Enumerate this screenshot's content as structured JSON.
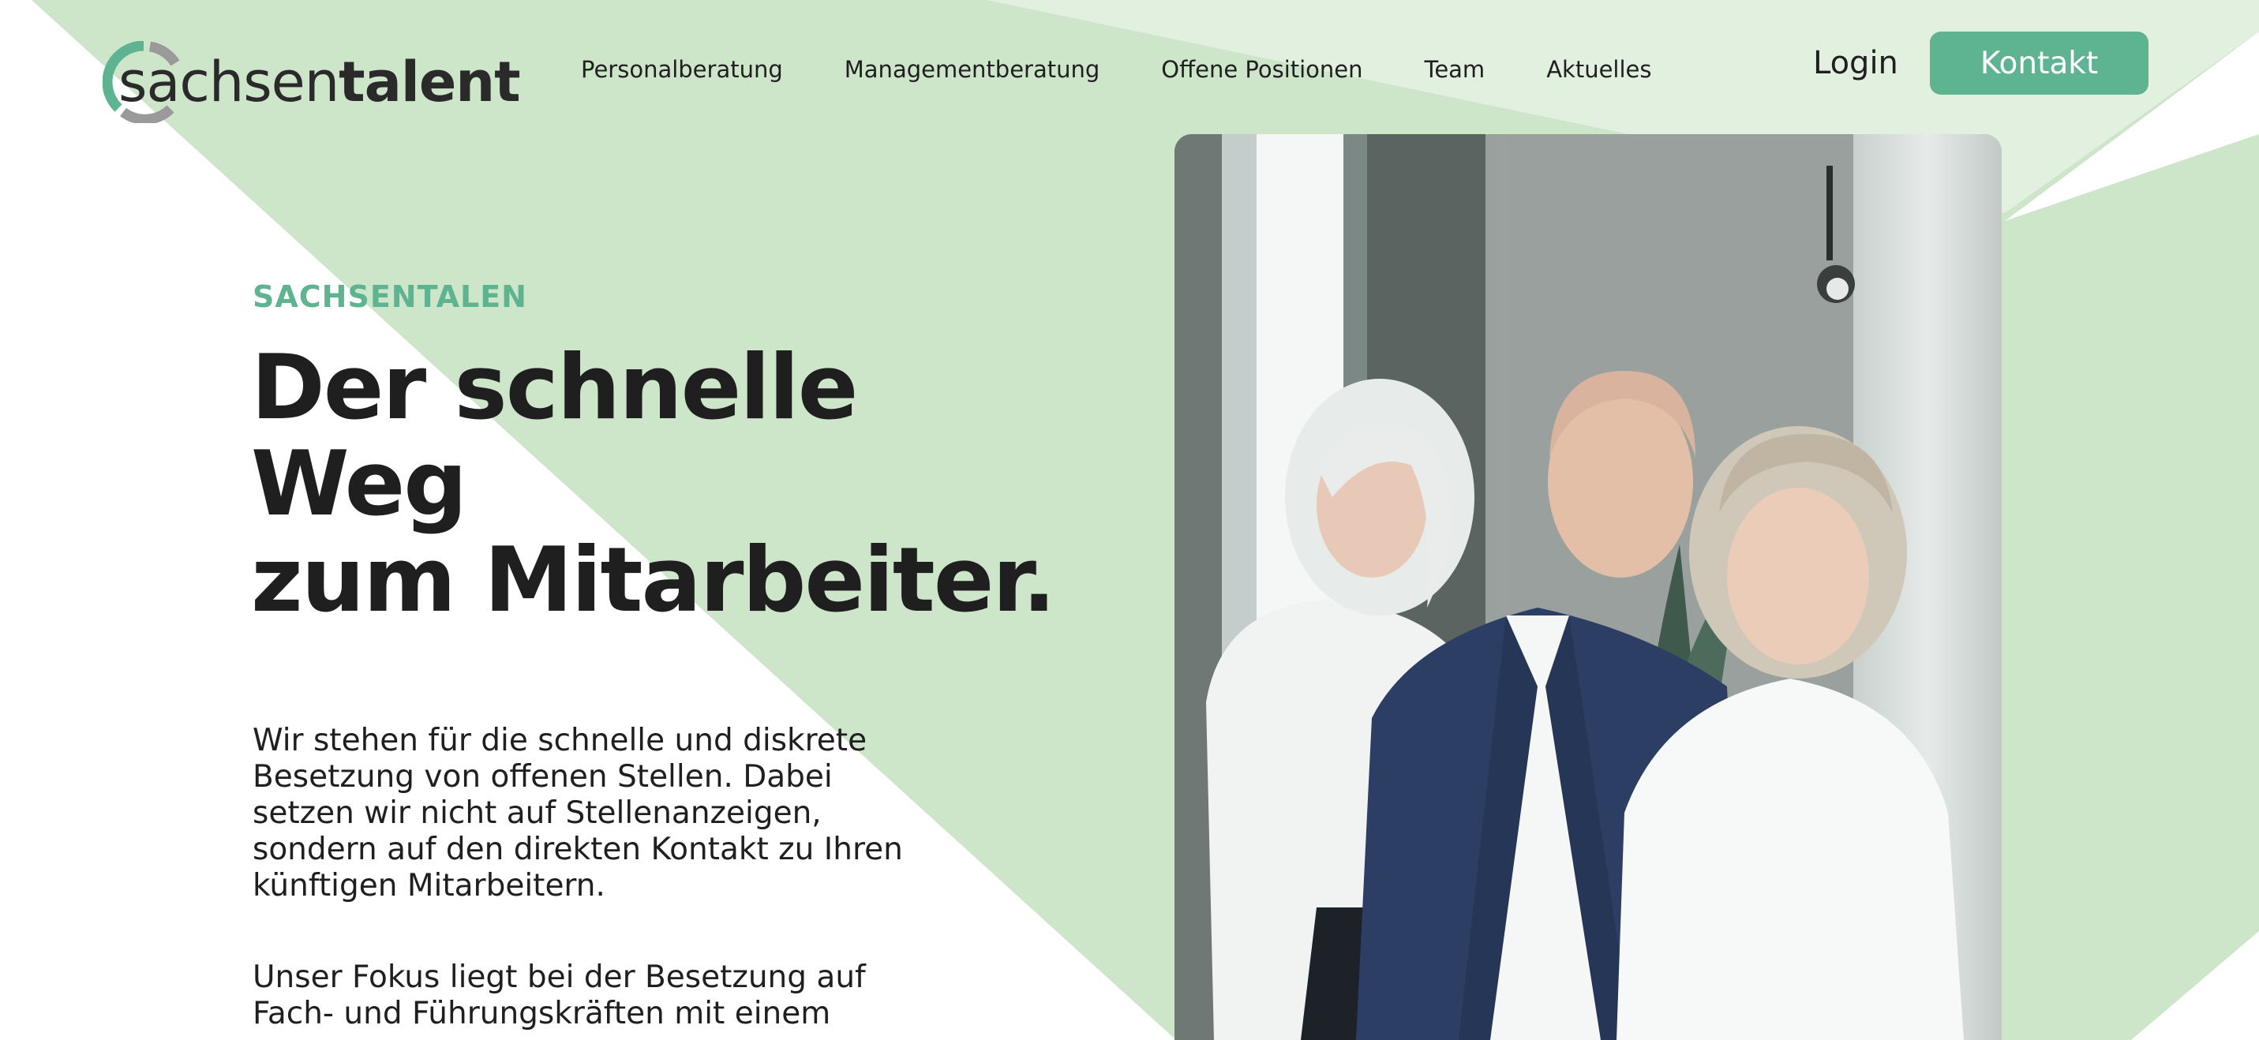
{
  "logo": {
    "text_light": "sachsen",
    "text_bold": "talent",
    "brand_color": "#5eb391",
    "ring_color": "#9a9a9a"
  },
  "nav": {
    "items": [
      {
        "label": "Personalberatung"
      },
      {
        "label": "Managementberatung"
      },
      {
        "label": "Offene Positionen"
      },
      {
        "label": "Team"
      },
      {
        "label": "Aktuelles"
      }
    ]
  },
  "header": {
    "login_label": "Login",
    "contact_label": "Kontakt"
  },
  "hero": {
    "eyebrow": "SACHSENTALEN",
    "headline_lines": [
      "Der schnelle",
      "Weg",
      "zum Mitarbeiter."
    ],
    "paragraph_1": "Wir stehen für die schnelle und diskrete Besetzung von offenen Stellen. Dabei setzen wir nicht auf Stellenanzeigen, sondern auf den direkten Kontakt zu Ihren künftigen Mitarbeitern.",
    "paragraph_2": "Unser Fokus liegt bei der Besetzung auf Fach- und Führungskräften mit einem"
  },
  "colors": {
    "accent": "#5eb391",
    "background_green": "#cde5c9",
    "text": "#1f1f1f"
  },
  "photo": {
    "icon": "team-photo"
  }
}
